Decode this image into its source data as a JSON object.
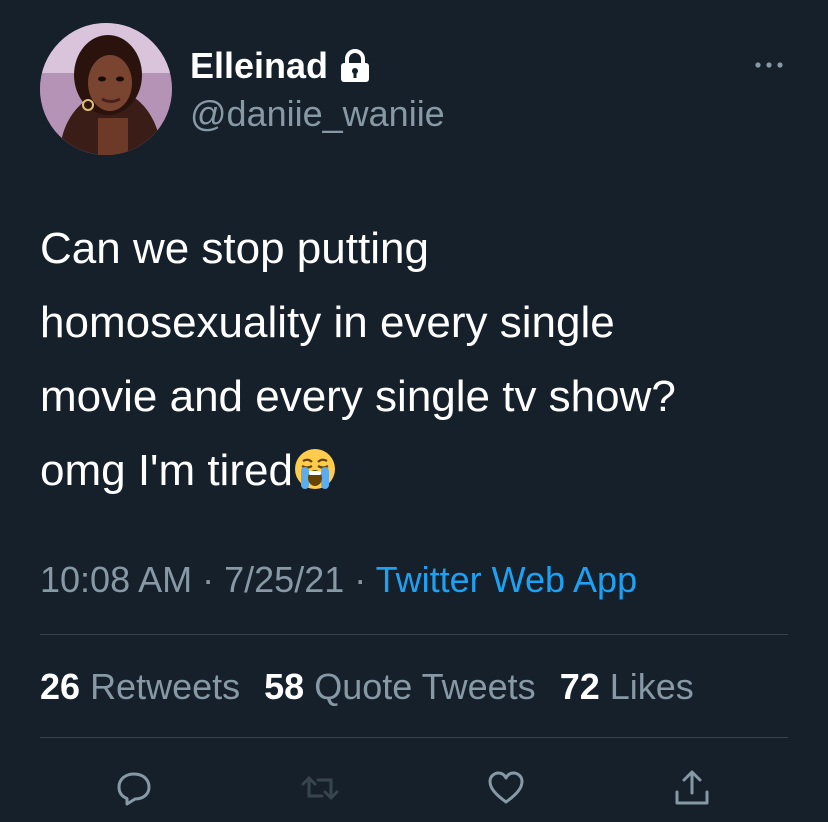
{
  "user": {
    "display_name": "Elleinad",
    "handle": "@daniie_waniie",
    "protected_icon": "lock-icon",
    "avatar": "profile photo"
  },
  "tweet": {
    "lines": [
      "Can we stop putting",
      "homosexuality in every single",
      "movie and every single tv show?",
      "omg I'm tired"
    ],
    "emoji": "loudly-crying-face-emoji",
    "time": "10:08 AM",
    "separator": "·",
    "date": "7/25/21",
    "source": "Twitter Web App"
  },
  "stats": {
    "retweets_count": "26",
    "retweets_label": "Retweets",
    "quotes_count": "58",
    "quotes_label": "Quote Tweets",
    "likes_count": "72",
    "likes_label": "Likes"
  },
  "actions": [
    "reply-icon",
    "retweet-icon",
    "like-icon",
    "share-icon"
  ],
  "colors": {
    "background": "#15202b",
    "text": "#ffffff",
    "secondary": "#8899a6",
    "accent": "#1da1f2",
    "divider": "#38444d"
  }
}
